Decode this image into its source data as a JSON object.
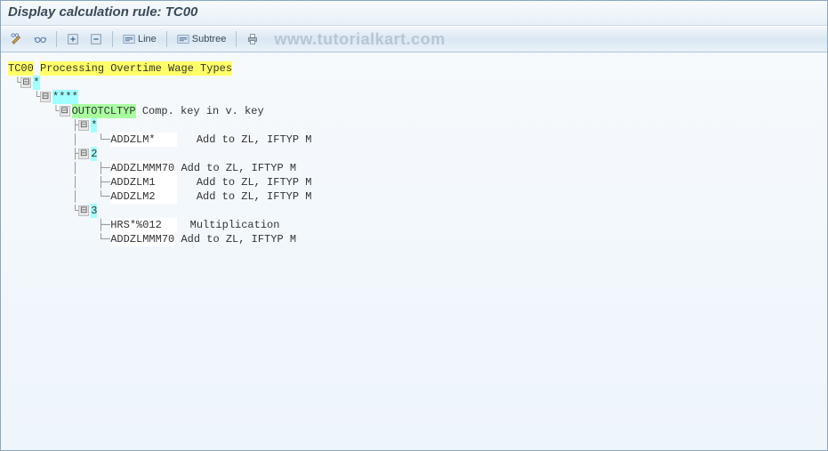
{
  "title": "Display calculation rule: TC00",
  "watermark": "www.tutorialkart.com",
  "toolbar": {
    "line_label": "Line",
    "subtree_label": "Subtree"
  },
  "tree": {
    "root_code": "TC00",
    "root_desc": "Processing Overtime Wage Types",
    "n1": "*",
    "n2": "****",
    "n3_code": "OUTOTCLTYP",
    "n3_desc": "Comp. key in v. key",
    "n4": "*",
    "n4_1_code": "ADDZLM*",
    "n4_1_desc": "Add to ZL, IFTYP M",
    "n5": "2",
    "n5_1_code": "ADDZLMMM70",
    "n5_1_desc": "Add to ZL, IFTYP M",
    "n5_2_code": "ADDZLM1",
    "n5_2_desc": "Add to ZL, IFTYP M",
    "n5_3_code": "ADDZLM2",
    "n5_3_desc": "Add to ZL, IFTYP M",
    "n6": "3",
    "n6_1_code": "HRS*%012",
    "n6_1_desc": "Multiplication",
    "n6_2_code": "ADDZLMMM70",
    "n6_2_desc": "Add to ZL, IFTYP M"
  }
}
